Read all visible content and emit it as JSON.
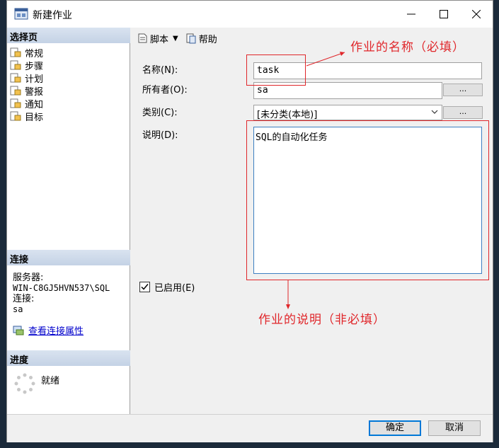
{
  "window": {
    "title": "新建作业"
  },
  "left": {
    "pages_header": "选择页",
    "pages": [
      "常规",
      "步骤",
      "计划",
      "警报",
      "通知",
      "目标"
    ],
    "connection_header": "连接",
    "server_label": "服务器:",
    "server_value": "WIN-C8GJ5HVN537\\SQL",
    "conn_label": "连接:",
    "conn_value": "sa",
    "view_props": "查看连接属性",
    "progress_header": "进度",
    "progress_status": "就绪"
  },
  "toolbar": {
    "script": "脚本",
    "help": "帮助"
  },
  "form": {
    "name_label": "名称(N):",
    "name_value": "task",
    "owner_label": "所有者(O):",
    "owner_value": "sa",
    "category_label": "类别(C):",
    "category_value": "[未分类(本地)]",
    "desc_label": "说明(D):",
    "desc_value": "SQL的自动化任务",
    "enabled_label": "已启用(E)",
    "ellipsis": "..."
  },
  "annotations": {
    "name_note": "作业的名称（必填）",
    "desc_note": "作业的说明（非必填）"
  },
  "footer": {
    "ok": "确定",
    "cancel": "取消"
  },
  "colors": {
    "annotation": "#e0262a",
    "accent": "#0078d7"
  }
}
